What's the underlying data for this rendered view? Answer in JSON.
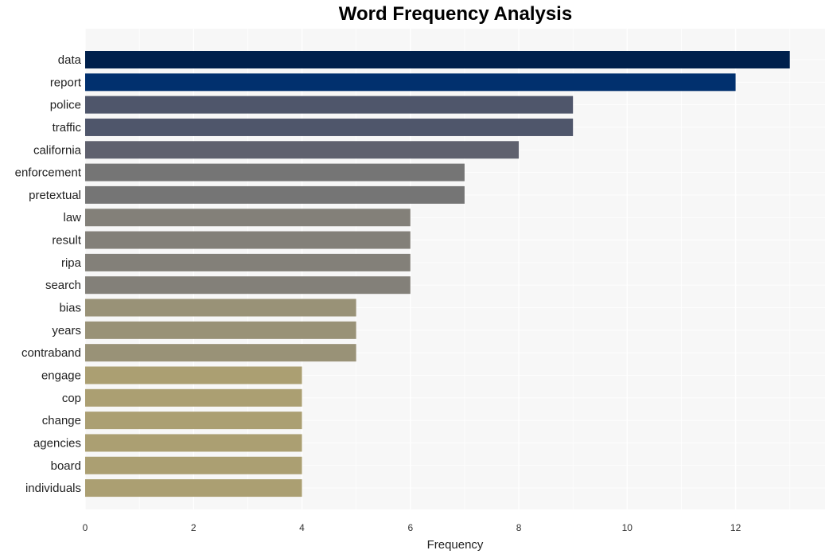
{
  "chart_data": {
    "type": "bar",
    "orientation": "horizontal",
    "title": "Word Frequency Analysis",
    "xlabel": "Frequency",
    "ylabel": "",
    "xlim": [
      0,
      13.65
    ],
    "xticks": [
      0,
      2,
      4,
      6,
      8,
      10,
      12
    ],
    "grid": true,
    "categories": [
      "data",
      "report",
      "police",
      "traffic",
      "california",
      "enforcement",
      "pretextual",
      "law",
      "result",
      "ripa",
      "search",
      "bias",
      "years",
      "contraband",
      "engage",
      "cop",
      "change",
      "agencies",
      "board",
      "individuals"
    ],
    "values": [
      13,
      12,
      9,
      9,
      8,
      7,
      7,
      6,
      6,
      6,
      6,
      5,
      5,
      5,
      4,
      4,
      4,
      4,
      4,
      4
    ],
    "colors": [
      "#00204c",
      "#01306e",
      "#4f566b",
      "#4f566b",
      "#5f616e",
      "#757575",
      "#757575",
      "#838079",
      "#838079",
      "#838079",
      "#838079",
      "#999277",
      "#999277",
      "#999277",
      "#ab9f72",
      "#ab9f72",
      "#ab9f72",
      "#ab9f72",
      "#ab9f72",
      "#ab9f72"
    ],
    "background": "#f7f7f7"
  }
}
